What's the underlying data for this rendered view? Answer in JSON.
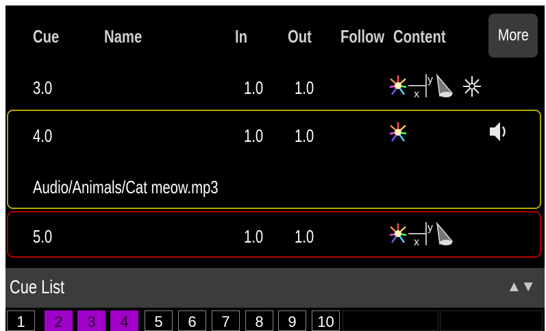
{
  "header": {
    "cue": "Cue",
    "name": "Name",
    "in": "In",
    "out": "Out",
    "follow": "Follow",
    "content": "Content",
    "more": "More"
  },
  "rows": [
    {
      "cue": "3.0",
      "in": "1.0",
      "out": "1.0",
      "icons": [
        "color-icon",
        "position-xy-icon",
        "beam-icon",
        "gobo-icon"
      ]
    },
    {
      "cue": "4.0",
      "in": "1.0",
      "out": "1.0",
      "name": "Audio/Animals/Cat meow.mp3",
      "icons": [
        "color-icon",
        "speaker-icon"
      ],
      "highlight": "#b4a800"
    },
    {
      "cue": "5.0",
      "in": "1.0",
      "out": "1.0",
      "icons": [
        "color-icon",
        "position-xy-icon",
        "beam-icon"
      ],
      "highlight": "#b50000"
    }
  ],
  "cue_list": {
    "title": "Cue List",
    "sort_icon": "up-down-arrows-icon",
    "pages": [
      "1",
      "2",
      "3",
      "4",
      "5",
      "6",
      "7",
      "8",
      "9",
      "10"
    ],
    "selected_pages": [
      "2",
      "3",
      "4"
    ],
    "selected_color": "#a000c8"
  }
}
